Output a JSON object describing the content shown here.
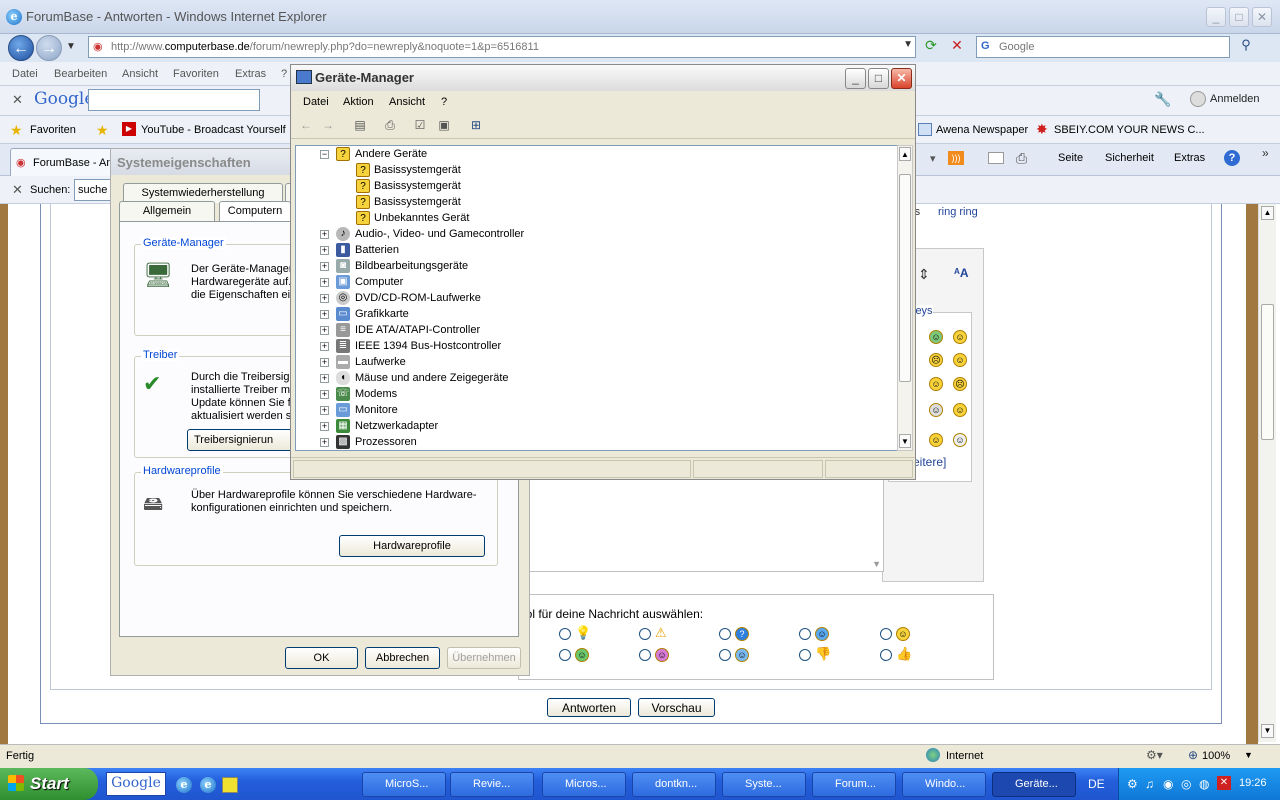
{
  "browser": {
    "title": "ForumBase - Antworten - Windows Internet Explorer",
    "url_prefix": "http://www.",
    "url_domain": "computerbase.de",
    "url_rest": "/forum/newreply.php?do=newreply&noquote=1&p=6516811",
    "search_placeholder": "Google",
    "menu": [
      "Datei",
      "Bearbeiten",
      "Ansicht",
      "Favoriten",
      "Extras",
      "?"
    ],
    "google_toolbar": {
      "logo": "Google",
      "anmelden": "Anmelden"
    },
    "favorites": {
      "label": "Favoriten",
      "items": [
        "YouTube - Broadcast Yourself",
        "Awena Newspaper",
        "SBEIY.COM  YOUR NEWS C..."
      ]
    },
    "tab": {
      "label": "ForumBase - Ant..."
    },
    "command_bar": {
      "seite": "Seite",
      "sicherheit": "Sicherheit",
      "extras": "Extras"
    },
    "find": {
      "label": "Suchen:",
      "value": "suche"
    },
    "status": {
      "text": "Fertig",
      "zone": "Internet",
      "zoom": "100%"
    }
  },
  "forum": {
    "ring_prefix": "t als",
    "ring_link": "ring ring",
    "smileys_label": "leys",
    "more_link": "eitere]",
    "symbol_label": "bol für deine Nachricht auswählen:",
    "buttons": {
      "reply": "Antworten",
      "preview": "Vorschau"
    }
  },
  "sysprops": {
    "title": "Systemeigenschaften",
    "tabs": [
      "Systemwiederherstellung",
      "Allgemein",
      "Computern"
    ],
    "groups": {
      "devmgr": {
        "label": "Geräte-Manager",
        "text1": "Der Geräte-Manager",
        "text2": "Hardwaregeräte auf.",
        "text3": "die Eigenschaften ei"
      },
      "driver": {
        "label": "Treiber",
        "text1": "Durch die Treibersign",
        "text2": "installierte Treiber mit",
        "text3": "Update können Sie f",
        "text4": "aktualisiert werden so",
        "button": "Treibersignierun"
      },
      "hwprofiles": {
        "label": "Hardwareprofile",
        "text1": "Über Hardwareprofile können Sie verschiedene Hardware-",
        "text2": "konfigurationen einrichten und speichern.",
        "button": "Hardwareprofile"
      }
    },
    "buttons": {
      "ok": "OK",
      "cancel": "Abbrechen",
      "apply": "Übernehmen"
    }
  },
  "devmgr": {
    "title": "Geräte-Manager",
    "menu": [
      "Datei",
      "Aktion",
      "Ansicht",
      "?"
    ],
    "tree": {
      "open_category": "Andere Geräte",
      "children": [
        "Basissystemgerät",
        "Basissystemgerät",
        "Basissystemgerät",
        "Unbekanntes Gerät"
      ],
      "categories": [
        "Audio-, Video- und Gamecontroller",
        "Batterien",
        "Bildbearbeitungsgeräte",
        "Computer",
        "DVD/CD-ROM-Laufwerke",
        "Grafikkarte",
        "IDE ATA/ATAPI-Controller",
        "IEEE 1394 Bus-Hostcontroller",
        "Laufwerke",
        "Mäuse und andere Zeigegeräte",
        "Modems",
        "Monitore",
        "Netzwerkadapter",
        "Prozessoren"
      ]
    }
  },
  "taskbar": {
    "start": "Start",
    "google": "Google",
    "buttons": [
      "MicroS...",
      "Revie...",
      "Micros...",
      "dontkn...",
      "Syste...",
      "Forum...",
      "Windo...",
      "Geräte..."
    ],
    "lang": "DE",
    "clock": "19:26"
  }
}
